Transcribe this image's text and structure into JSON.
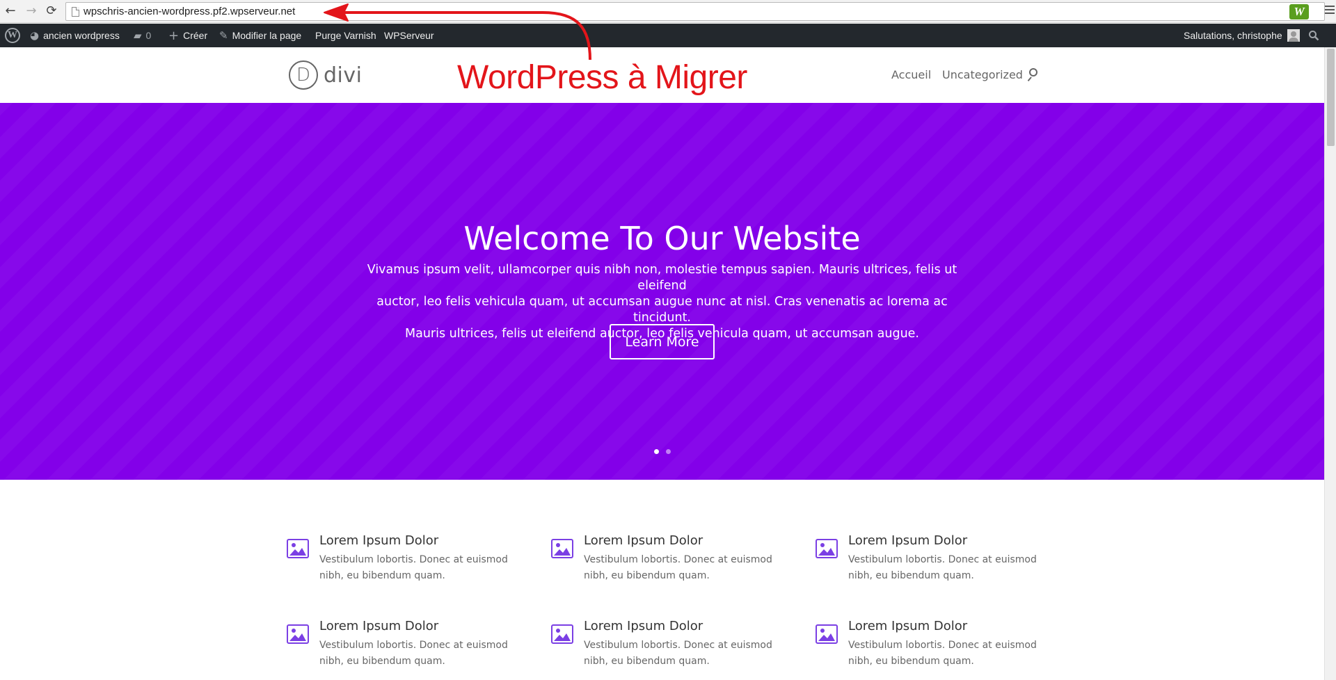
{
  "browser": {
    "url": "wpschris-ancien-wordpress.pf2.wpserveur.net",
    "back_glyph": "←",
    "forward_glyph": "→",
    "reload_glyph": "⟳",
    "extension_letter": "W"
  },
  "admin_bar": {
    "wp_logo_letter": "W",
    "site_name": "ancien wordpress",
    "comments_count": "0",
    "new_label": "Créer",
    "edit_label": "Modifier la page",
    "purge_label": "Purge Varnish",
    "host_label": "WPServeur",
    "greeting": "Salutations, christophe"
  },
  "site": {
    "logo_letter": "D",
    "logo_text": "divi",
    "nav": [
      {
        "label": "Accueil"
      },
      {
        "label": "Uncategorized"
      }
    ]
  },
  "annotation": {
    "text": "WordPress à Migrer",
    "color": "#e3151a"
  },
  "hero": {
    "background_color": "#8300e9",
    "title": "Welcome To Our Website",
    "body_lines": [
      "Vivamus ipsum velit, ullamcorper quis nibh non, molestie tempus sapien. Mauris ultrices, felis ut eleifend",
      "auctor, leo felis vehicula quam, ut accumsan augue nunc at nisl. Cras venenatis ac lorema ac tincidunt.",
      "Mauris ultrices, felis ut eleifend auctor, leo felis vehicula quam, ut accumsan augue."
    ],
    "button_label": "Learn More",
    "slides": 2,
    "active_slide": 1
  },
  "blurbs": [
    {
      "title": "Lorem Ipsum Dolor",
      "text": "Vestibulum lobortis. Donec at euismod nibh, eu bibendum quam."
    },
    {
      "title": "Lorem Ipsum Dolor",
      "text": "Vestibulum lobortis. Donec at euismod nibh, eu bibendum quam."
    },
    {
      "title": "Lorem Ipsum Dolor",
      "text": "Vestibulum lobortis. Donec at euismod nibh, eu bibendum quam."
    },
    {
      "title": "Lorem Ipsum Dolor",
      "text": "Vestibulum lobortis. Donec at euismod nibh, eu bibendum quam."
    },
    {
      "title": "Lorem Ipsum Dolor",
      "text": "Vestibulum lobortis. Donec at euismod nibh, eu bibendum quam."
    },
    {
      "title": "Lorem Ipsum Dolor",
      "text": "Vestibulum lobortis. Donec at euismod nibh, eu bibendum quam."
    }
  ],
  "accent_color": "#7b3fe4"
}
